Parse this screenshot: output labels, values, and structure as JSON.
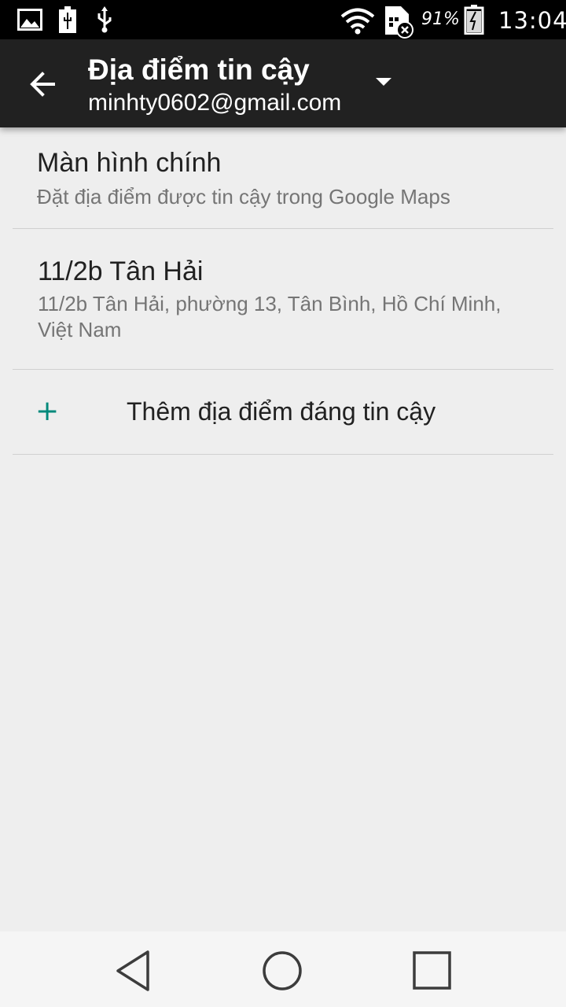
{
  "status_bar": {
    "battery_percent": "91%",
    "time": "13:04",
    "icons": [
      "image-icon",
      "battery-charging-icon",
      "usb-icon",
      "wifi-icon",
      "sim-error-icon",
      "battery-icon"
    ]
  },
  "toolbar": {
    "title": "Địa điểm tin cậy",
    "account": "minhty0602@gmail.com",
    "back_icon": "arrow-back-icon",
    "dropdown_icon": "dropdown-arrow-icon"
  },
  "list": {
    "items": [
      {
        "title": "Màn hình chính",
        "subtitle": "Đặt địa điểm được tin cậy trong Google Maps"
      },
      {
        "title": "11/2b Tân Hải",
        "subtitle": "11/2b Tân Hải, phường 13, Tân Bình, Hồ Chí Minh, Việt Nam"
      }
    ],
    "add_label": "Thêm địa điểm đáng tin cậy",
    "add_icon": "plus-icon"
  },
  "nav_bar": {
    "icons": [
      "back-nav-icon",
      "home-nav-icon",
      "recents-nav-icon"
    ]
  },
  "colors": {
    "toolbar": "#212121",
    "background": "#eeeeee",
    "accent": "#00897b"
  }
}
